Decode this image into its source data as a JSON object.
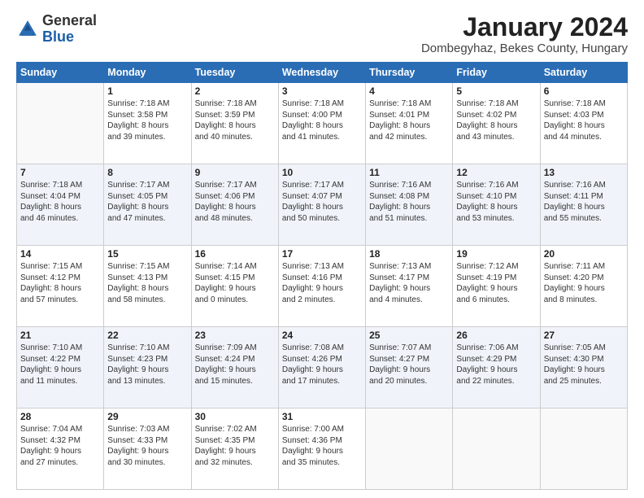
{
  "header": {
    "logo": {
      "line1": "General",
      "line2": "Blue"
    },
    "title": "January 2024",
    "subtitle": "Dombegyhaz, Bekes County, Hungary"
  },
  "weekdays": [
    "Sunday",
    "Monday",
    "Tuesday",
    "Wednesday",
    "Thursday",
    "Friday",
    "Saturday"
  ],
  "weeks": [
    [
      {
        "day": "",
        "sunrise": "",
        "sunset": "",
        "daylight": ""
      },
      {
        "day": "1",
        "sunrise": "Sunrise: 7:18 AM",
        "sunset": "Sunset: 3:58 PM",
        "daylight": "Daylight: 8 hours and 39 minutes."
      },
      {
        "day": "2",
        "sunrise": "Sunrise: 7:18 AM",
        "sunset": "Sunset: 3:59 PM",
        "daylight": "Daylight: 8 hours and 40 minutes."
      },
      {
        "day": "3",
        "sunrise": "Sunrise: 7:18 AM",
        "sunset": "Sunset: 4:00 PM",
        "daylight": "Daylight: 8 hours and 41 minutes."
      },
      {
        "day": "4",
        "sunrise": "Sunrise: 7:18 AM",
        "sunset": "Sunset: 4:01 PM",
        "daylight": "Daylight: 8 hours and 42 minutes."
      },
      {
        "day": "5",
        "sunrise": "Sunrise: 7:18 AM",
        "sunset": "Sunset: 4:02 PM",
        "daylight": "Daylight: 8 hours and 43 minutes."
      },
      {
        "day": "6",
        "sunrise": "Sunrise: 7:18 AM",
        "sunset": "Sunset: 4:03 PM",
        "daylight": "Daylight: 8 hours and 44 minutes."
      }
    ],
    [
      {
        "day": "7",
        "sunrise": "Sunrise: 7:18 AM",
        "sunset": "Sunset: 4:04 PM",
        "daylight": "Daylight: 8 hours and 46 minutes."
      },
      {
        "day": "8",
        "sunrise": "Sunrise: 7:17 AM",
        "sunset": "Sunset: 4:05 PM",
        "daylight": "Daylight: 8 hours and 47 minutes."
      },
      {
        "day": "9",
        "sunrise": "Sunrise: 7:17 AM",
        "sunset": "Sunset: 4:06 PM",
        "daylight": "Daylight: 8 hours and 48 minutes."
      },
      {
        "day": "10",
        "sunrise": "Sunrise: 7:17 AM",
        "sunset": "Sunset: 4:07 PM",
        "daylight": "Daylight: 8 hours and 50 minutes."
      },
      {
        "day": "11",
        "sunrise": "Sunrise: 7:16 AM",
        "sunset": "Sunset: 4:08 PM",
        "daylight": "Daylight: 8 hours and 51 minutes."
      },
      {
        "day": "12",
        "sunrise": "Sunrise: 7:16 AM",
        "sunset": "Sunset: 4:10 PM",
        "daylight": "Daylight: 8 hours and 53 minutes."
      },
      {
        "day": "13",
        "sunrise": "Sunrise: 7:16 AM",
        "sunset": "Sunset: 4:11 PM",
        "daylight": "Daylight: 8 hours and 55 minutes."
      }
    ],
    [
      {
        "day": "14",
        "sunrise": "Sunrise: 7:15 AM",
        "sunset": "Sunset: 4:12 PM",
        "daylight": "Daylight: 8 hours and 57 minutes."
      },
      {
        "day": "15",
        "sunrise": "Sunrise: 7:15 AM",
        "sunset": "Sunset: 4:13 PM",
        "daylight": "Daylight: 8 hours and 58 minutes."
      },
      {
        "day": "16",
        "sunrise": "Sunrise: 7:14 AM",
        "sunset": "Sunset: 4:15 PM",
        "daylight": "Daylight: 9 hours and 0 minutes."
      },
      {
        "day": "17",
        "sunrise": "Sunrise: 7:13 AM",
        "sunset": "Sunset: 4:16 PM",
        "daylight": "Daylight: 9 hours and 2 minutes."
      },
      {
        "day": "18",
        "sunrise": "Sunrise: 7:13 AM",
        "sunset": "Sunset: 4:17 PM",
        "daylight": "Daylight: 9 hours and 4 minutes."
      },
      {
        "day": "19",
        "sunrise": "Sunrise: 7:12 AM",
        "sunset": "Sunset: 4:19 PM",
        "daylight": "Daylight: 9 hours and 6 minutes."
      },
      {
        "day": "20",
        "sunrise": "Sunrise: 7:11 AM",
        "sunset": "Sunset: 4:20 PM",
        "daylight": "Daylight: 9 hours and 8 minutes."
      }
    ],
    [
      {
        "day": "21",
        "sunrise": "Sunrise: 7:10 AM",
        "sunset": "Sunset: 4:22 PM",
        "daylight": "Daylight: 9 hours and 11 minutes."
      },
      {
        "day": "22",
        "sunrise": "Sunrise: 7:10 AM",
        "sunset": "Sunset: 4:23 PM",
        "daylight": "Daylight: 9 hours and 13 minutes."
      },
      {
        "day": "23",
        "sunrise": "Sunrise: 7:09 AM",
        "sunset": "Sunset: 4:24 PM",
        "daylight": "Daylight: 9 hours and 15 minutes."
      },
      {
        "day": "24",
        "sunrise": "Sunrise: 7:08 AM",
        "sunset": "Sunset: 4:26 PM",
        "daylight": "Daylight: 9 hours and 17 minutes."
      },
      {
        "day": "25",
        "sunrise": "Sunrise: 7:07 AM",
        "sunset": "Sunset: 4:27 PM",
        "daylight": "Daylight: 9 hours and 20 minutes."
      },
      {
        "day": "26",
        "sunrise": "Sunrise: 7:06 AM",
        "sunset": "Sunset: 4:29 PM",
        "daylight": "Daylight: 9 hours and 22 minutes."
      },
      {
        "day": "27",
        "sunrise": "Sunrise: 7:05 AM",
        "sunset": "Sunset: 4:30 PM",
        "daylight": "Daylight: 9 hours and 25 minutes."
      }
    ],
    [
      {
        "day": "28",
        "sunrise": "Sunrise: 7:04 AM",
        "sunset": "Sunset: 4:32 PM",
        "daylight": "Daylight: 9 hours and 27 minutes."
      },
      {
        "day": "29",
        "sunrise": "Sunrise: 7:03 AM",
        "sunset": "Sunset: 4:33 PM",
        "daylight": "Daylight: 9 hours and 30 minutes."
      },
      {
        "day": "30",
        "sunrise": "Sunrise: 7:02 AM",
        "sunset": "Sunset: 4:35 PM",
        "daylight": "Daylight: 9 hours and 32 minutes."
      },
      {
        "day": "31",
        "sunrise": "Sunrise: 7:00 AM",
        "sunset": "Sunset: 4:36 PM",
        "daylight": "Daylight: 9 hours and 35 minutes."
      },
      {
        "day": "",
        "sunrise": "",
        "sunset": "",
        "daylight": ""
      },
      {
        "day": "",
        "sunrise": "",
        "sunset": "",
        "daylight": ""
      },
      {
        "day": "",
        "sunrise": "",
        "sunset": "",
        "daylight": ""
      }
    ]
  ]
}
